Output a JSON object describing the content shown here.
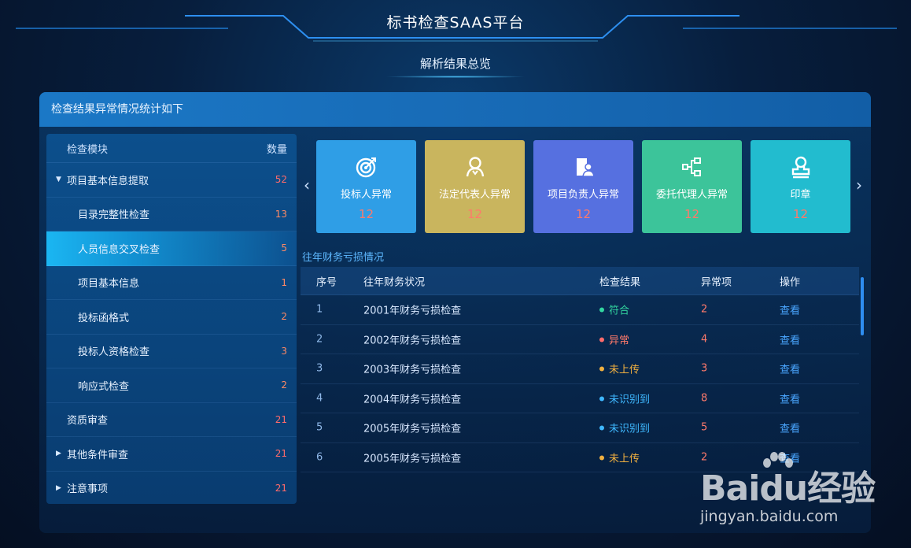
{
  "header": {
    "title": "标书检查SAAS平台",
    "subtitle": "解析结果总览"
  },
  "panel": {
    "title": "检查结果异常情况统计如下"
  },
  "tree": {
    "col_module": "检查模块",
    "col_count": "数量",
    "items": [
      {
        "label": "项目基本信息提取",
        "count": "52"
      },
      {
        "label": "目录完整性检查",
        "count": "13"
      },
      {
        "label": "人员信息交叉检查",
        "count": "5"
      },
      {
        "label": "项目基本信息",
        "count": "1"
      },
      {
        "label": "投标函格式",
        "count": "2"
      },
      {
        "label": "投标人资格检查",
        "count": "3"
      },
      {
        "label": "响应式检查",
        "count": "2"
      },
      {
        "label": "资质审查",
        "count": "21"
      },
      {
        "label": "其他条件审查",
        "count": "21"
      },
      {
        "label": "注意事项",
        "count": "21"
      }
    ]
  },
  "cards": [
    {
      "label": "投标人异常",
      "value": "12",
      "icon": "target-icon",
      "color": "#2f9ee6"
    },
    {
      "label": "法定代表人异常",
      "value": "12",
      "icon": "person-icon",
      "color": "#c9b55e"
    },
    {
      "label": "项目负责人异常",
      "value": "12",
      "icon": "id-card-icon",
      "color": "#5670e0"
    },
    {
      "label": "委托代理人异常",
      "value": "12",
      "icon": "network-icon",
      "color": "#3cc49a"
    },
    {
      "label": "印章",
      "value": "12",
      "icon": "stamp-icon",
      "color": "#22bccf"
    }
  ],
  "finance": {
    "title": "往年财务亏损情况",
    "columns": [
      "序号",
      "往年财务状况",
      "检查结果",
      "异常项",
      "操作"
    ],
    "rows": [
      {
        "idx": "1",
        "name": "2001年财务亏损检查",
        "result": "符合",
        "abnormal": "2",
        "action": "查看"
      },
      {
        "idx": "2",
        "name": "2002年财务亏损检查",
        "result": "异常",
        "abnormal": "4",
        "action": "查看"
      },
      {
        "idx": "3",
        "name": "2003年财务亏损检查",
        "result": "未上传",
        "abnormal": "3",
        "action": "查看"
      },
      {
        "idx": "4",
        "name": "2004年财务亏损检查",
        "result": "未识别到",
        "abnormal": "8",
        "action": "查看"
      },
      {
        "idx": "5",
        "name": "2005年财务亏损检查",
        "result": "未识别到",
        "abnormal": "5",
        "action": "查看"
      },
      {
        "idx": "6",
        "name": "2005年财务亏损检查",
        "result": "未上传",
        "abnormal": "2",
        "action": "查看"
      }
    ]
  },
  "watermark": {
    "brand": "Bai",
    "brand_du": "du",
    "brand_cn": "经验",
    "url": "jingyan.baidu.com"
  }
}
